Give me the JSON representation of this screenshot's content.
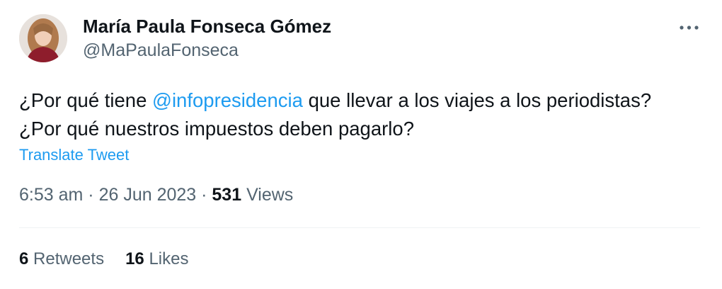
{
  "author": {
    "display_name": "María Paula Fonseca Gómez",
    "handle": "@MaPaulaFonseca"
  },
  "tweet": {
    "line1_before": "¿Por qué tiene ",
    "line1_mention": "@infopresidencia",
    "line1_after": " que llevar a los viajes a los periodistas?",
    "line2": "¿Por qué nuestros impuestos deben pagarlo?",
    "translate_label": "Translate Tweet"
  },
  "meta": {
    "time": "6:53 am",
    "separator": " · ",
    "date": "26 Jun 2023",
    "views_count": "531",
    "views_label": " Views"
  },
  "stats": {
    "retweets_count": "6",
    "retweets_label": " Retweets",
    "likes_count": "16",
    "likes_label": " Likes"
  },
  "icons": {
    "more": "more-dots-icon"
  },
  "colors": {
    "text_primary": "#0f1419",
    "text_secondary": "#536471",
    "link": "#1d9bf0",
    "divider": "#eff3f4"
  }
}
